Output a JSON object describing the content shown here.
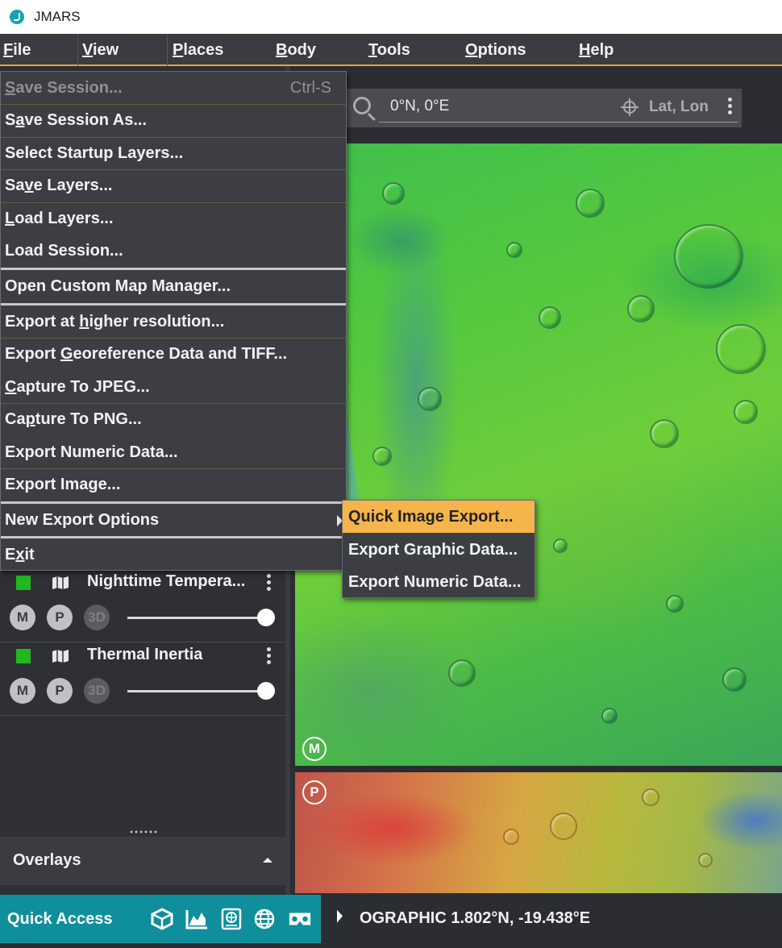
{
  "window": {
    "title": "JMARS"
  },
  "menubar": {
    "items": [
      {
        "label": "File",
        "u": "F",
        "rest": "ile"
      },
      {
        "label": "View",
        "u": "V",
        "rest": "iew"
      },
      {
        "label": "Places",
        "u": "P",
        "rest": "laces"
      },
      {
        "label": "Body",
        "u": "B",
        "rest": "ody"
      },
      {
        "label": "Tools",
        "u": "T",
        "rest": "ools"
      },
      {
        "label": "Options",
        "u": "O",
        "rest": "ptions"
      },
      {
        "label": "Help",
        "u": "H",
        "rest": "elp"
      }
    ]
  },
  "search": {
    "value": "0°N, 0°E",
    "mode_label": "Lat, Lon"
  },
  "file_menu": {
    "save_session": {
      "pre": "",
      "u": "S",
      "post": "ave Session...",
      "accelerator": "Ctrl-S"
    },
    "save_session_as": {
      "pre": "S",
      "u": "a",
      "post": "ve Session As..."
    },
    "select_startup_layers": {
      "label": "Select Startup Layers..."
    },
    "save_layers": {
      "pre": "Sa",
      "u": "v",
      "post": "e Layers..."
    },
    "load_layers": {
      "pre": "",
      "u": "L",
      "post": "oad Layers..."
    },
    "load_session": {
      "label": "Load Session..."
    },
    "open_custom_map_manager": {
      "label": "Open Custom Map Manager..."
    },
    "export_higher_res": {
      "pre": "Export at ",
      "u": "h",
      "post": "igher resolution..."
    },
    "export_georef": {
      "pre": "Export ",
      "u": "G",
      "post": "eoreference Data and TIFF..."
    },
    "capture_jpeg": {
      "pre": "",
      "u": "C",
      "post": "apture To JPEG..."
    },
    "capture_png": {
      "pre": "Ca",
      "u": "p",
      "post": "ture To PNG..."
    },
    "export_numeric": {
      "label": "Export Numeric Data..."
    },
    "export_image": {
      "label": "Export Image..."
    },
    "new_export_options": {
      "label": "New Export Options"
    },
    "exit": {
      "pre": "E",
      "u": "x",
      "post": "it"
    }
  },
  "submenu": {
    "items": [
      {
        "label": "Quick Image Export..."
      },
      {
        "label": "Export Graphic Data..."
      },
      {
        "label": "Export Numeric Data..."
      }
    ]
  },
  "layers": [
    {
      "name": "Nighttime Tempera...",
      "btn_m": "M",
      "btn_p": "P",
      "btn_3d": "3D",
      "opacity": 1.0,
      "color": "#1fb81f"
    },
    {
      "name": "Thermal Inertia",
      "btn_m": "M",
      "btn_p": "P",
      "btn_3d": "3D",
      "opacity": 1.0,
      "color": "#1fb81f"
    }
  ],
  "overlays": {
    "label": "Overlays"
  },
  "map": {
    "main_badge": "M",
    "second_badge": "P"
  },
  "quick_access": {
    "label": "Quick Access",
    "icons": [
      "box-3d-icon",
      "chart-icon",
      "globe-book-icon",
      "globe-icon",
      "vr-headset-icon"
    ]
  },
  "status": {
    "text": "OGRAPHIC  1.802°N, -19.438°E"
  },
  "colors": {
    "accent": "#e8a33a",
    "highlight": "#f5b54a",
    "quick_access_bg": "#0f8f9b",
    "layer_swatch": "#1fb81f"
  }
}
